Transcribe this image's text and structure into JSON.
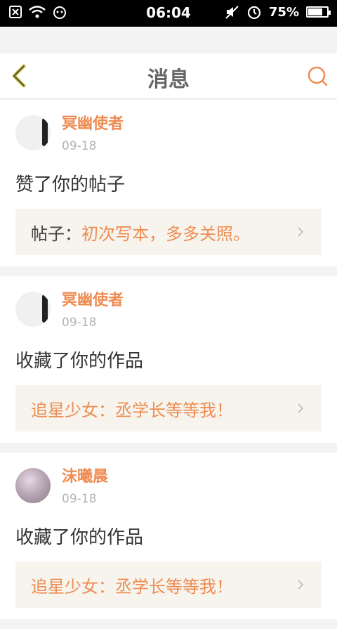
{
  "status_bar": {
    "time": "06:04",
    "battery": "75%",
    "battery_level": 0.75
  },
  "header": {
    "title": "消息"
  },
  "messages": [
    {
      "name": "冥幽使者",
      "date": "09-18",
      "action": "赞了你的帖子",
      "ref_label": "帖子：",
      "ref_value": "初次写本，多多关照。"
    },
    {
      "name": "冥幽使者",
      "date": "09-18",
      "action": "收藏了你的作品",
      "ref_label": "",
      "ref_value": "追星少女：丞学长等等我！"
    },
    {
      "name": "沫曦晨",
      "date": "09-18",
      "action": "收藏了你的作品",
      "ref_label": "",
      "ref_value": "追星少女：丞学长等等我！"
    }
  ],
  "colors": {
    "accent": "#ef8c52",
    "back_icon": "#c8c04a",
    "ref_bg": "#f6f4ed"
  },
  "icons": [
    "sim-icon",
    "wifi-icon",
    "alarm-icon",
    "mute-icon",
    "battery-icon",
    "back-icon",
    "search-icon",
    "chevron-right-icon"
  ]
}
